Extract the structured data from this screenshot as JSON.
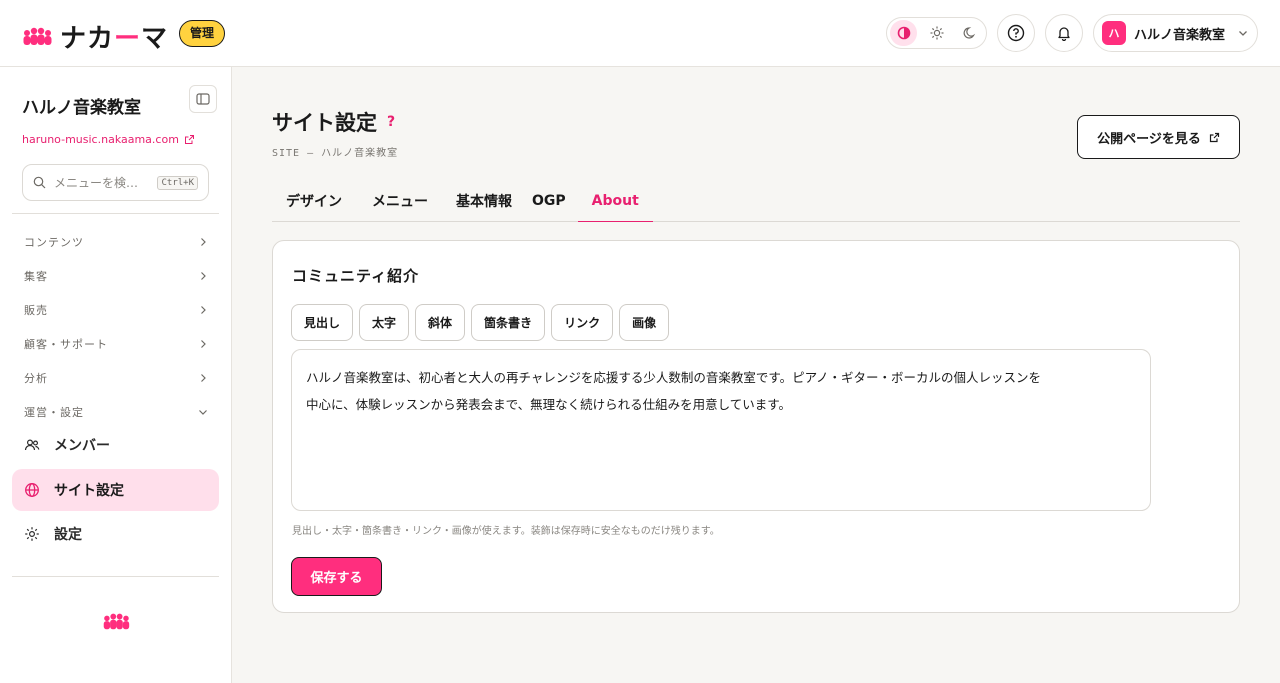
{
  "header": {
    "logo_text_pre": "ナカ",
    "logo_text_dash": "ー",
    "logo_text_post": "マ",
    "admin_badge": "管理",
    "account_initial": "ハ",
    "account_name": "ハルノ音楽教室"
  },
  "sidebar": {
    "site_name": "ハルノ音楽教室",
    "site_url": "haruno-music.nakaama.com",
    "search_placeholder": "メニューを検…",
    "search_shortcut": "Ctrl+K",
    "groups": [
      {
        "label": "コンテンツ"
      },
      {
        "label": "集客"
      },
      {
        "label": "販売"
      },
      {
        "label": "顧客・サポート"
      },
      {
        "label": "分析"
      },
      {
        "label": "運営・設定"
      }
    ],
    "items": [
      {
        "label": "メンバー"
      },
      {
        "label": "サイト設定"
      },
      {
        "label": "設定"
      }
    ]
  },
  "main": {
    "title": "サイト設定",
    "help_mark": "?",
    "breadcrumb": "SITE — ハルノ音楽教室",
    "public_button": "公開ページを見る",
    "tabs": [
      {
        "label": "デザイン"
      },
      {
        "label": "メニュー"
      },
      {
        "label": "基本情報"
      },
      {
        "label": "OGP"
      },
      {
        "label": "About"
      }
    ],
    "active_tab": "About",
    "card": {
      "title": "コミュニティ紹介",
      "toolbar": [
        {
          "label": "見出し"
        },
        {
          "label": "太字"
        },
        {
          "label": "斜体"
        },
        {
          "label": "箇条書き"
        },
        {
          "label": "リンク"
        },
        {
          "label": "画像"
        }
      ],
      "editor_line1": "ハルノ音楽教室は、初心者と大人の再チャレンジを応援する少人数制の音楽教室です。ピアノ・ギター・ボーカルの個人レッスンを",
      "editor_line2": "中心に、体験レッスンから発表会まで、無理なく続けられる仕組みを用意しています。",
      "hint": "見出し・太字・箇条書き・リンク・画像が使えます。装飾は保存時に安全なものだけ残ります。",
      "save_button": "保存する"
    }
  },
  "colors": {
    "accent": "#ff2e7e",
    "accent_text": "#e8206f",
    "badge": "#ffd23f",
    "active_bg": "#ffdfeb",
    "main_bg": "#f7f6f3"
  },
  "icons": [
    "people-logo-icon",
    "contrast-icon",
    "sun-icon",
    "moon-icon",
    "help-icon",
    "bell-icon",
    "chevron-down-icon",
    "sidebar-toggle-icon",
    "external-link-icon",
    "search-icon",
    "chevron-right-icon",
    "members-icon",
    "globe-icon",
    "gear-icon"
  ]
}
